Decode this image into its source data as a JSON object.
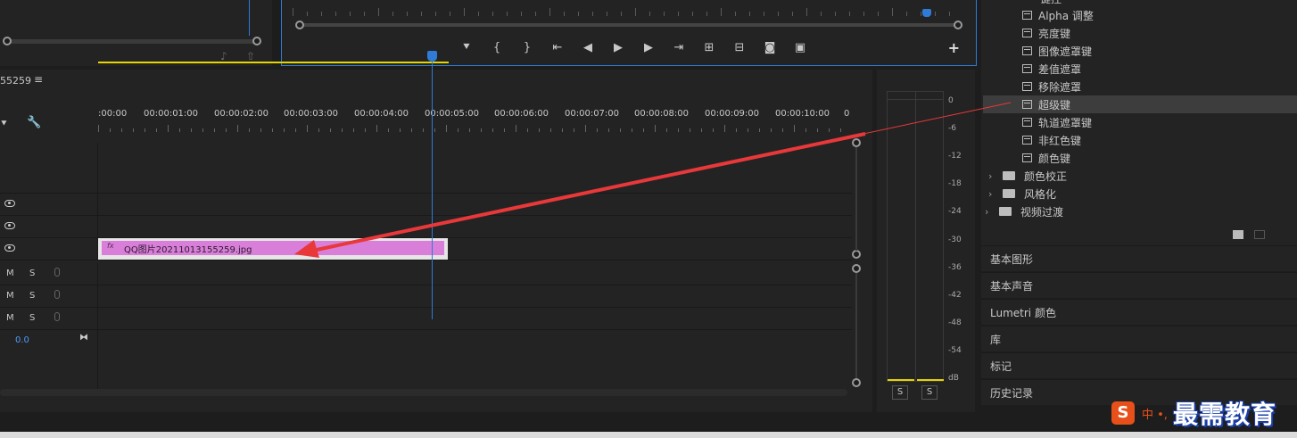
{
  "timeline": {
    "sequence_name": "55259",
    "menu_glyph": "≡",
    "timecodes": [
      ":00:00",
      "00:00:01:00",
      "00:00:02:00",
      "00:00:03:00",
      "00:00:04:00",
      "00:00:05:00",
      "00:00:06:00",
      "00:00:07:00",
      "00:00:08:00",
      "00:00:09:00",
      "00:00:10:00",
      "0"
    ],
    "clip": {
      "fx_label": "fx",
      "name": "QQ图片20211013155259.jpg"
    },
    "audio_tracks": [
      {
        "m": "M",
        "s": "S"
      },
      {
        "m": "M",
        "s": "S"
      },
      {
        "m": "M",
        "s": "S"
      }
    ],
    "master_value": "0.0"
  },
  "effects": {
    "top_cut_label": "键控",
    "items": [
      "Alpha 调整",
      "亮度键",
      "图像遮罩键",
      "差值遮罩",
      "移除遮罩",
      "超级键",
      "轨道遮罩键",
      "非红色键",
      "颜色键"
    ],
    "selected_index": 5,
    "folders": [
      "颜色校正",
      "风格化"
    ],
    "top_folder": "视频过渡"
  },
  "collapsed_panels": [
    "基本图形",
    "基本声音",
    "Lumetri 颜色",
    "库",
    "标记",
    "历史记录"
  ],
  "meter": {
    "db_labels": [
      "0",
      "-6",
      "-12",
      "-18",
      "-24",
      "-30",
      "-36",
      "-42",
      "-48",
      "-54",
      "dB"
    ],
    "solo_left": "S",
    "solo_right": "S"
  },
  "watermark": {
    "badge": "S",
    "mid": "中 •,",
    "text": "最需教育"
  },
  "colors": {
    "accent_blue": "#2f7bd6",
    "clip_pink": "#d97fd9",
    "work_area_yellow": "#e6d400",
    "arrow_red": "#e8383a"
  }
}
